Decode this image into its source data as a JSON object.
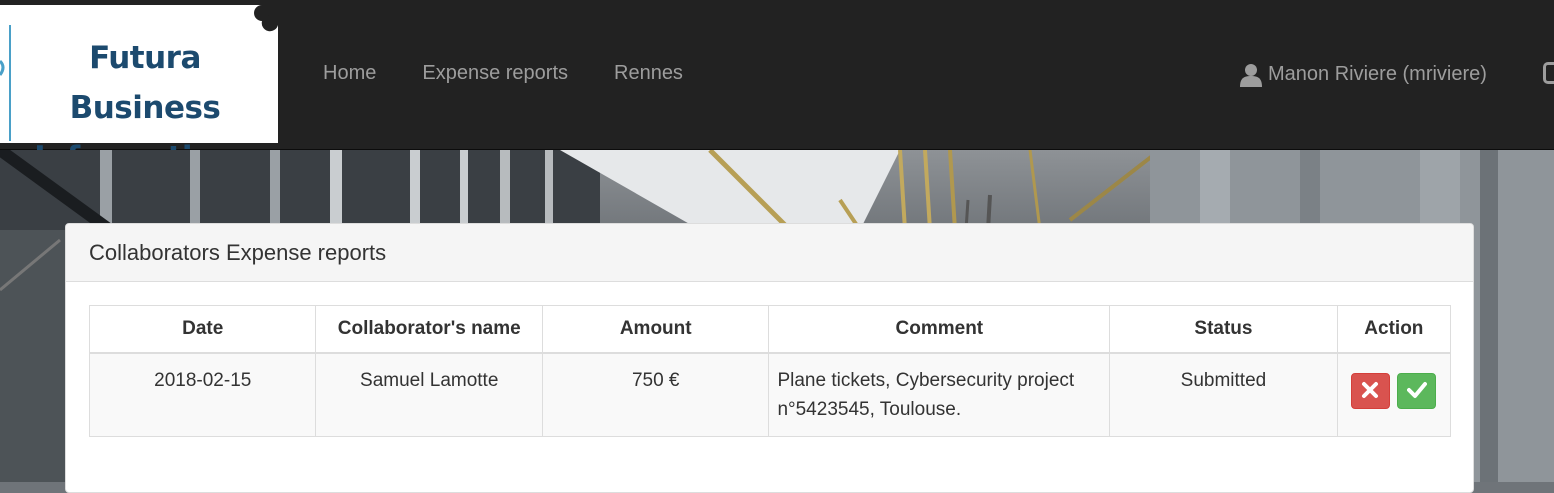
{
  "logo": {
    "line1": "Futura Business",
    "line2": "Informatique"
  },
  "nav": {
    "links": [
      {
        "label": "Home"
      },
      {
        "label": "Expense reports"
      },
      {
        "label": "Rennes"
      }
    ],
    "user_label": "Manon Riviere (mriviere)",
    "user_icon": "user-icon"
  },
  "panel": {
    "title": "Collaborators Expense reports",
    "table": {
      "headers": [
        "Date",
        "Collaborator's name",
        "Amount",
        "Comment",
        "Status",
        "Action"
      ],
      "rows": [
        {
          "date": "2018-02-15",
          "name": "Samuel Lamotte",
          "amount": "750 €",
          "comment": "Plane tickets, Cybersecurity project n°5423545, Toulouse.",
          "status": "Submitted",
          "actions": [
            "reject-icon",
            "approve-icon"
          ]
        }
      ]
    }
  },
  "colors": {
    "navbar_bg": "#222222",
    "nav_text": "#9d9d9d",
    "logo_text": "#1c4a6e",
    "reject_btn": "#d9534f",
    "approve_btn": "#5cb85c"
  }
}
